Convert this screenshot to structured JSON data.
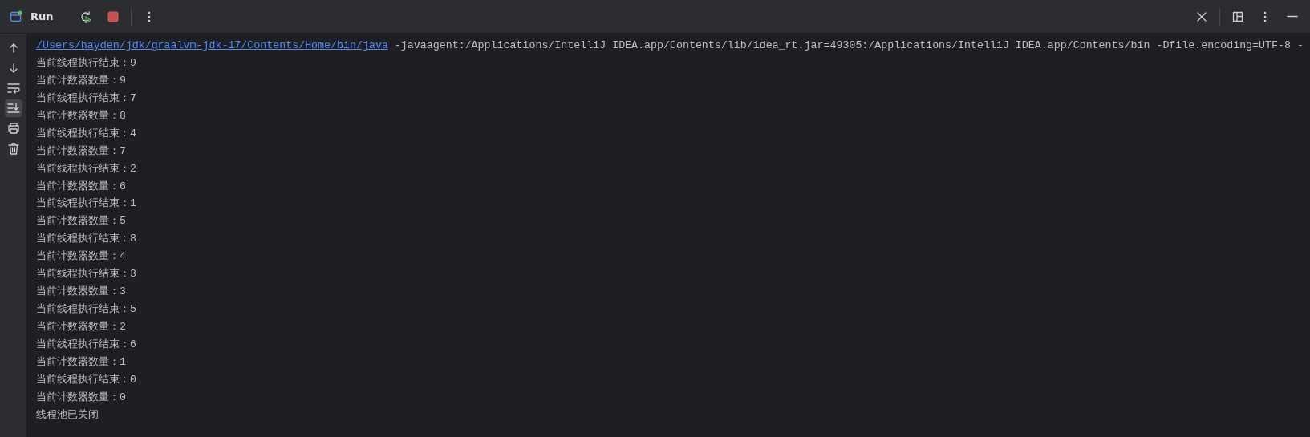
{
  "tool_window": {
    "title": "Run"
  },
  "side_toolbar": [
    {
      "kind": "up",
      "on": false
    },
    {
      "kind": "down",
      "on": false
    },
    {
      "kind": "wrap",
      "on": false
    },
    {
      "kind": "scroll_end",
      "on": true
    },
    {
      "kind": "print",
      "on": false
    },
    {
      "kind": "trash",
      "on": false
    }
  ],
  "console": {
    "command_path": "/Users/hayden/jdk/graalvm-jdk-17/Contents/Home/bin/java",
    "command_args": "-javaagent:/Applications/IntelliJ IDEA.app/Contents/lib/idea_rt.jar=49305:/Applications/IntelliJ IDEA.app/Contents/bin -Dfile.encoding=UTF-8 -",
    "lines": [
      "当前线程执行结束：9",
      "当前计数器数量：9",
      "当前线程执行结束：7",
      "当前计数器数量：8",
      "当前线程执行结束：4",
      "当前计数器数量：7",
      "当前线程执行结束：2",
      "当前计数器数量：6",
      "当前线程执行结束：1",
      "当前计数器数量：5",
      "当前线程执行结束：8",
      "当前计数器数量：4",
      "当前线程执行结束：3",
      "当前计数器数量：3",
      "当前线程执行结束：5",
      "当前计数器数量：2",
      "当前线程执行结束：6",
      "当前计数器数量：1",
      "当前线程执行结束：0",
      "当前计数器数量：0",
      "线程池已关闭"
    ]
  }
}
